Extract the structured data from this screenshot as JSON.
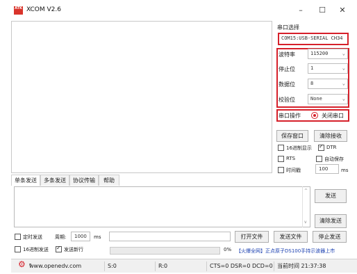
{
  "app": {
    "title": "XCOM V2.6",
    "logo_text": "ATK"
  },
  "window": {
    "minimize": "–",
    "maximize": "☐",
    "close": "✕"
  },
  "serial_select": {
    "label": "串口选择",
    "value": "COM15:USB-SERIAL CH34"
  },
  "settings": {
    "baud": {
      "label": "波特率",
      "value": "115200"
    },
    "stop_bits": {
      "label": "停止位",
      "value": "1"
    },
    "data_bits": {
      "label": "数据位",
      "value": "8"
    },
    "parity": {
      "label": "校验位",
      "value": "None"
    }
  },
  "port_op": {
    "label": "串口操作",
    "button": "关闭串口"
  },
  "buttons": {
    "save_window": "保存窗口",
    "clear_recv": "清除接收",
    "send": "发送",
    "clear_send": "清除发送",
    "open_file": "打开文件",
    "send_file": "发送文件",
    "stop_send": "停止发送"
  },
  "options": {
    "hex_display": "16进制显示",
    "dtr": "DTR",
    "rts": "RTS",
    "auto_save": "自动保存",
    "timestamp": "时间戳",
    "timestamp_value": "100",
    "timestamp_unit": "ms"
  },
  "tabs": [
    "单条发送",
    "多条发送",
    "协议传输",
    "帮助"
  ],
  "send_options": {
    "timed_send": "定时发送",
    "period_label": "周期:",
    "period_value": "1000",
    "period_unit": "ms",
    "hex_send": "16进制发送",
    "send_newline": "发送新行",
    "progress_text": "0%",
    "progress": 0,
    "ad_text": "【火爆全网】正点原子DS100手持示波器上市"
  },
  "status": {
    "website": "www.openedv.com",
    "sent": "S:0",
    "received": "R:0",
    "lines": "CTS=0 DSR=0 DCD=0",
    "time": "当前时间 21:37:38"
  },
  "colors": {
    "accent_red": "#d6202a",
    "link_blue": "#1a3fb0"
  }
}
